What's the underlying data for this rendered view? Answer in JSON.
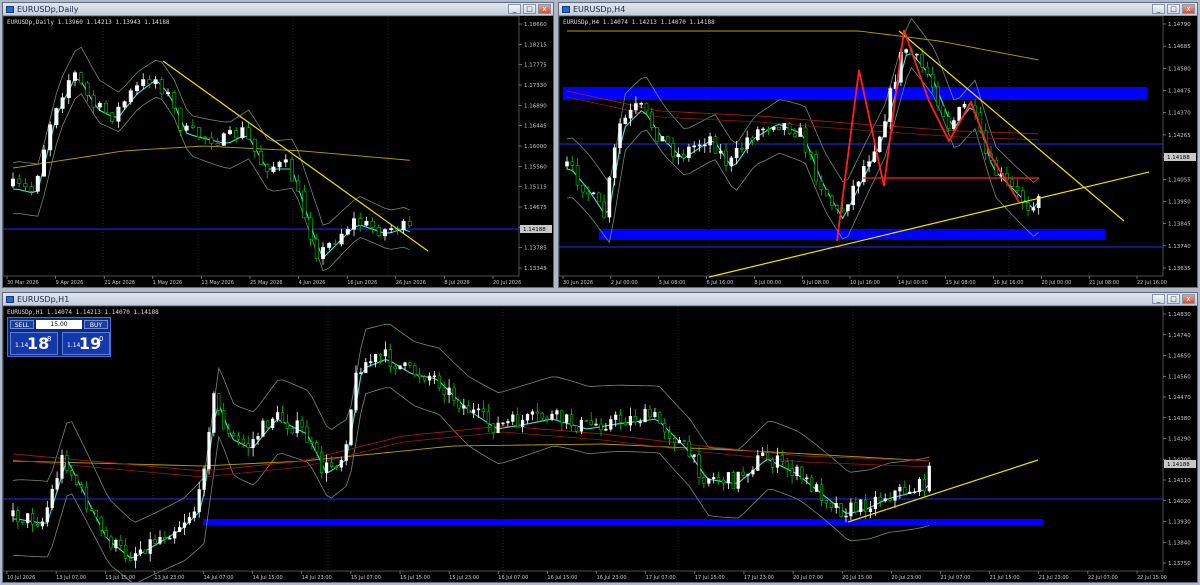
{
  "windows": {
    "daily": {
      "title": "EURUSDp,Daily",
      "info": "EURUSDp,Daily  1.13960 1.14213 1.13943 1.14188",
      "price_labels": [
        "1.18660",
        "1.18215",
        "1.17775",
        "1.17330",
        "1.16890",
        "1.16445",
        "1.16000",
        "1.15560",
        "1.15115",
        "1.14675",
        "1.14230",
        "1.13785",
        "1.13345"
      ],
      "current_price": "1.14188",
      "time_labels": [
        "30 Mar 2026",
        "9 Apr 2026",
        "21 Apr 2026",
        "1 May 2026",
        "13 May 2026",
        "25 May 2026",
        "4 Jun 2026",
        "16 Jun 2026",
        "26 Jun 2026",
        "8 Jul 2026",
        "20 Jul 2026"
      ]
    },
    "h4": {
      "title": "EURUSDp,H4",
      "info": "EURUSDp,H4  1.14074 1.14213 1.14070 1.14188",
      "price_labels": [
        "1.14790",
        "1.14685",
        "1.14580",
        "1.14475",
        "1.14370",
        "1.14265",
        "1.14160",
        "1.14055",
        "1.13950",
        "1.13845",
        "1.13740",
        "1.13635"
      ],
      "current_price": "1.14188",
      "time_labels": [
        "30 Jun 2026",
        "2 Jul 00:00",
        "3 Jul 08:00",
        "6 Jul 16:00",
        "8 Jul 00:00",
        "9 Jul 08:00",
        "10 Jul 16:00",
        "14 Jul 00:00",
        "15 Jul 08:00",
        "16 Jul 16:00",
        "20 Jul 00:00",
        "21 Jul 08:00",
        "22 Jul 16:00"
      ]
    },
    "h1": {
      "title": "EURUSDp,H1",
      "info": "EURUSDp,H1  1.14074 1.14213 1.14070 1.14188",
      "price_labels": [
        "1.14830",
        "1.14740",
        "1.14650",
        "1.14560",
        "1.14470",
        "1.14380",
        "1.14290",
        "1.14200",
        "1.14110",
        "1.14020",
        "1.13930",
        "1.13840",
        "1.13750"
      ],
      "current_price": "1.14188",
      "time_labels": [
        "10 Jul 2026",
        "13 Jul 07:00",
        "13 Jul 15:00",
        "13 Jul 23:00",
        "14 Jul 07:00",
        "14 Jul 15:00",
        "14 Jul 23:00",
        "15 Jul 07:00",
        "15 Jul 15:00",
        "15 Jul 23:00",
        "16 Jul 07:00",
        "16 Jul 15:00",
        "16 Jul 23:00",
        "17 Jul 07:00",
        "17 Jul 15:00",
        "17 Jul 23:00",
        "20 Jul 07:00",
        "20 Jul 15:00",
        "20 Jul 23:00",
        "21 Jul 07:00",
        "21 Jul 15:00",
        "21 Jul 23:00",
        "22 Jul 07:00",
        "22 Jul 15:00"
      ],
      "trade_panel": {
        "sell_label": "SELL",
        "buy_label": "BUY",
        "lot": "15.00",
        "sell_prefix": "1.14",
        "sell_big": "18",
        "sell_sup": "8",
        "buy_prefix": "1.14",
        "buy_big": "19",
        "buy_sup": "0"
      }
    }
  },
  "window_buttons": {
    "minimize": "_",
    "maximize": "□",
    "close": "x"
  },
  "colors": {
    "background": "#000000",
    "bull_candle": "#ffffff",
    "bear_candle": "#00c800",
    "support_zone": "#0000ff",
    "horizontal_line": "#1e2cff",
    "trendline": "#f2e000",
    "pattern": "#ff2020",
    "ma_fast": "#40e0d0",
    "ma_slow": "#b8a000",
    "ma_red": "#a01818",
    "bollinger": "#6c8c74",
    "grid": "#3a3a3a",
    "current_price_tag": "#c8c8c8"
  }
}
